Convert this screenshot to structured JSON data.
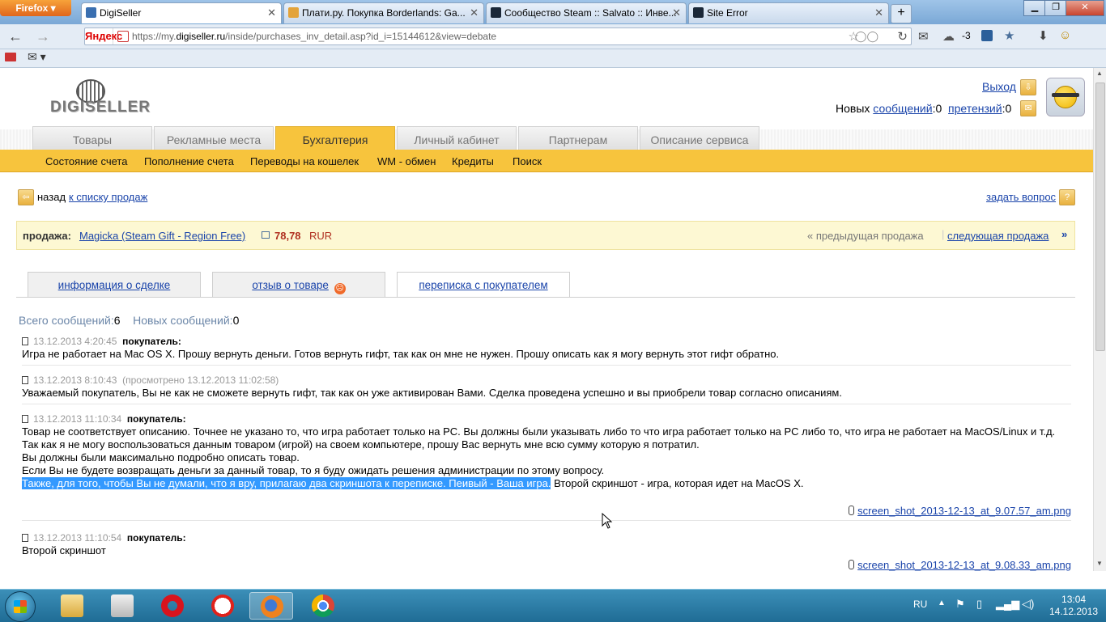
{
  "browser": {
    "app_button": "Firefox",
    "tabs": [
      {
        "title": "DigiSeller",
        "active": true
      },
      {
        "title": "Плати.ру. Покупка Borderlands: Ga...",
        "active": false
      },
      {
        "title": "Сообщество Steam :: Salvato :: Инве...",
        "active": false
      },
      {
        "title": "Site Error",
        "active": false
      }
    ],
    "search_engine": "Яндекс",
    "url_prefix": "https://my.",
    "url_domain": "digiseller.ru",
    "url_rest": "/inside/purchases_inv_detail.asp?id_i=15144612&view=debate",
    "weather": "-3"
  },
  "header": {
    "logo": "DIGISELLER",
    "logout": "Выход",
    "new_label": "Новых",
    "messages_link": "сообщений",
    "messages_count": ":0",
    "claims_link": "претензий",
    "claims_count": ":0"
  },
  "main_tabs": [
    "Товары",
    "Рекламные места",
    "Бухгалтерия",
    "Личный кабинет",
    "Партнерам",
    "Описание сервиса"
  ],
  "sub_menu": [
    "Состояние счета",
    "Пополнение счета",
    "Переводы на кошелек",
    "WM - обмен",
    "Кредиты",
    "Поиск"
  ],
  "back": {
    "label": "назад",
    "link": "к списку продаж"
  },
  "ask": "задать вопрос",
  "sale": {
    "label": "продажа:",
    "product": "Magicka (Steam Gift - Region Free)",
    "price": "78,78",
    "currency": "RUR",
    "prev": "предыдущая продажа",
    "next": "следующая продажа"
  },
  "detail_tabs": [
    "информация о сделке",
    "отзыв о товаре",
    "переписка с покупателем"
  ],
  "counts": {
    "total_label": "Всего сообщений:",
    "total": "6",
    "new_label": "Новых сообщений:",
    "new": "0"
  },
  "messages": [
    {
      "date": "13.12.2013 4:20:45",
      "author": "покупатель:",
      "text": "Игра не работает на Mac OS X. Прошу вернуть деньги. Готов вернуть гифт, так как он мне не нужен. Прошу описать как я могу вернуть этот гифт обратно."
    },
    {
      "date": "13.12.2013 8:10:43",
      "viewed": "(просмотрено 13.12.2013 11:02:58)",
      "text": "Уважаемый покупатель, Вы не как не сможете вернуть гифт, так как он уже активирован Вами. Сделка проведена успешно и вы приобрели товар согласно описаниям."
    },
    {
      "date": "13.12.2013 11:10:34",
      "author": "покупатель:",
      "line1": "Товар не соответствует описанию. Точнее не указано то, что игра работает только на PC. Вы должны были указывать либо то что игра работает только на PC либо то, что игра не работает на MacOS/Linux и т.д.",
      "line2": "Так как я не могу воспользоваться данным товаром (игрой) на своем компьютере, прошу Вас вернуть мне всю сумму которую я потратил.",
      "line3": "Вы должны были максимально подробно описать товар.",
      "line4": "Если Вы не будете возвращать деньги за данный товар, то я буду ожидать решения администрации по этому вопросу.",
      "line5_selected": "Также, для того, чтобы Вы не думали, что я вру, прилагаю два скриншота к переписке. Пеивый - Ваша игра.",
      "line5_rest": " Второй скриншот - игра, которая идет на MacOS X.",
      "attachment": "screen_shot_2013-12-13_at_9.07.57_am.png"
    },
    {
      "date": "13.12.2013 11:10:54",
      "author": "покупатель:",
      "text": "Второй скриншот",
      "attachment": "screen_shot_2013-12-13_at_9.08.33_am.png"
    }
  ],
  "taskbar": {
    "lang": "RU",
    "time": "13:04",
    "date": "14.12.2013"
  }
}
